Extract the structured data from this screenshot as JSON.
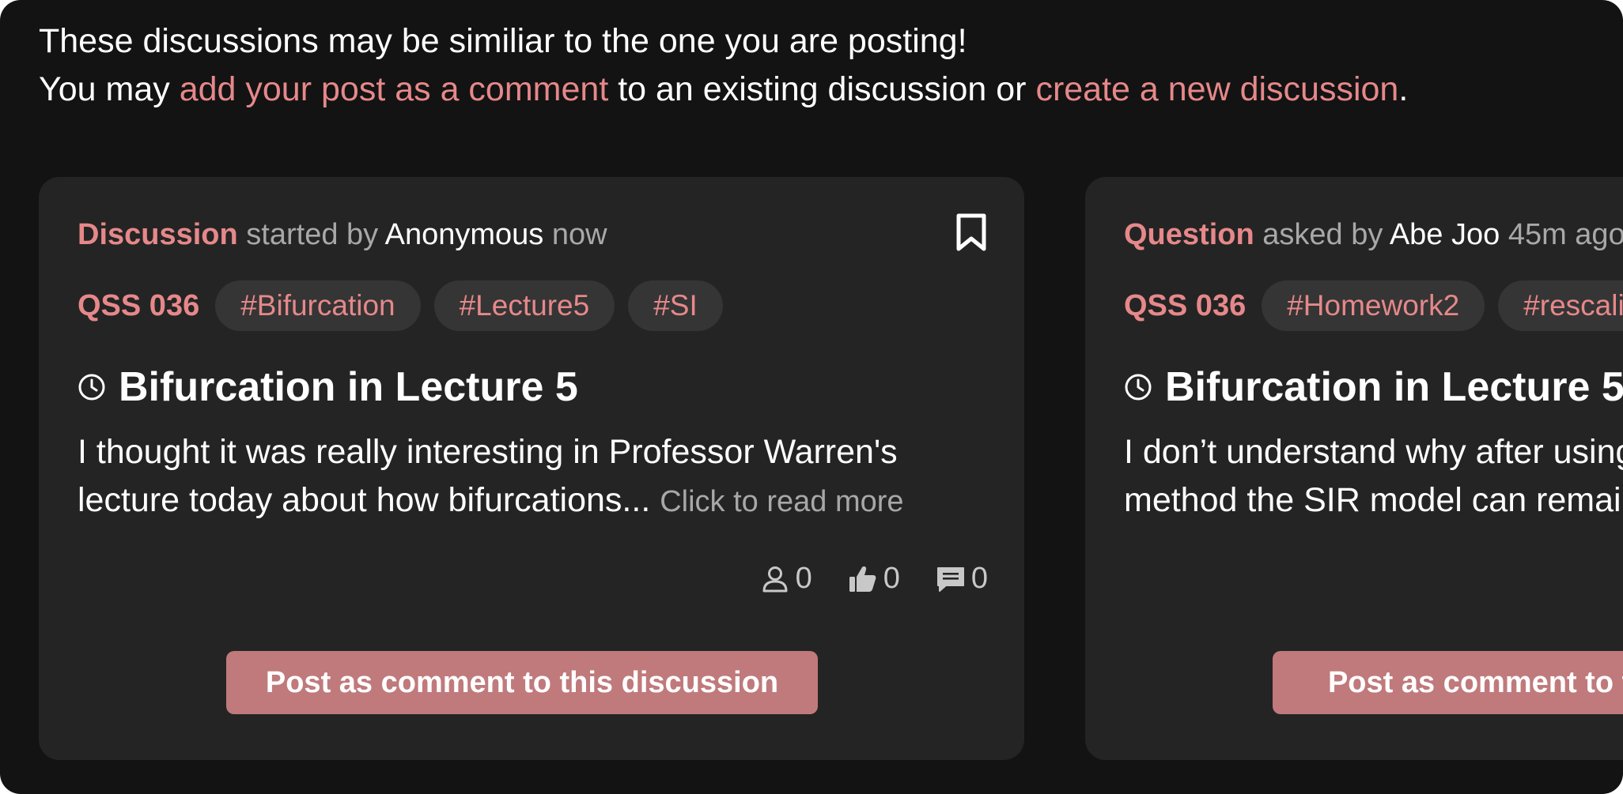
{
  "intro": {
    "line1": "These discussions may be similiar to the one you are posting!",
    "line2_prefix": "You may ",
    "link_comment": "add your post as a comment",
    "line2_middle": " to an existing discussion or ",
    "link_new": "create a new discussion",
    "line2_suffix": "."
  },
  "colors": {
    "accent": "#e6888a",
    "button": "#c07a7c",
    "card_bg": "#242424",
    "page_bg": "#131313"
  },
  "cards": [
    {
      "type": "Discussion",
      "verb": " started by ",
      "author": "Anonymous",
      "time": " now",
      "course": "QSS 036",
      "tags": [
        "#Bifurcation",
        "#Lecture5",
        "#SI"
      ],
      "title": "Bifurcation in Lecture 5",
      "body_line1": "I thought it was really interesting in Professor Warren's",
      "body_line2": "lecture today about how bifurcations... ",
      "read_more": "Click to read more",
      "views": "0",
      "likes": "0",
      "comments": "0",
      "button_label": "Post as comment to this discussion",
      "icons": [
        "bookmark-icon",
        "clock-icon",
        "user-icon",
        "thumbs-up-icon",
        "comment-icon"
      ]
    },
    {
      "type": "Question",
      "verb": " asked by ",
      "author": "Abe Joo",
      "time": " 45m ago",
      "course": "QSS 036",
      "tags": [
        "#Homework2",
        "#rescaling"
      ],
      "title": "Bifurcation in Lecture 5",
      "body_line1": "I don’t understand why after using the rescaling",
      "body_line2": "method the SIR model can remain the same",
      "button_label": "Post as comment to this question"
    }
  ]
}
